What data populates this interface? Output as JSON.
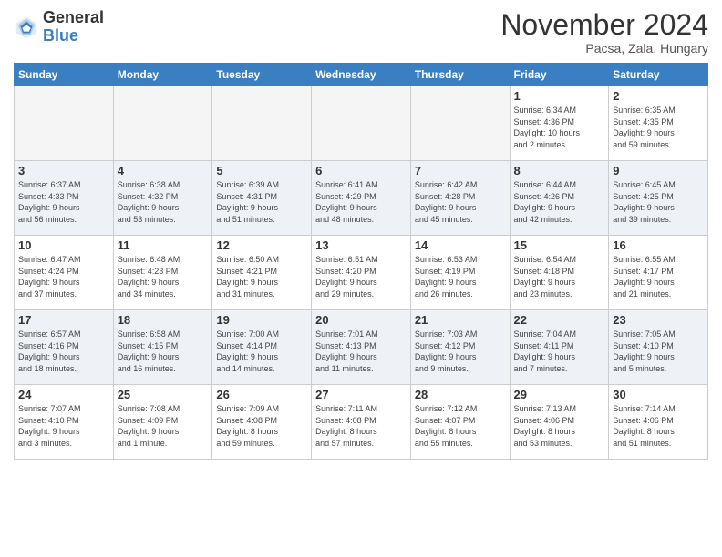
{
  "logo": {
    "general": "General",
    "blue": "Blue"
  },
  "header": {
    "title": "November 2024",
    "location": "Pacsa, Zala, Hungary"
  },
  "columns": [
    "Sunday",
    "Monday",
    "Tuesday",
    "Wednesday",
    "Thursday",
    "Friday",
    "Saturday"
  ],
  "weeks": [
    [
      {
        "day": "",
        "info": ""
      },
      {
        "day": "",
        "info": ""
      },
      {
        "day": "",
        "info": ""
      },
      {
        "day": "",
        "info": ""
      },
      {
        "day": "",
        "info": ""
      },
      {
        "day": "1",
        "info": "Sunrise: 6:34 AM\nSunset: 4:36 PM\nDaylight: 10 hours\nand 2 minutes."
      },
      {
        "day": "2",
        "info": "Sunrise: 6:35 AM\nSunset: 4:35 PM\nDaylight: 9 hours\nand 59 minutes."
      }
    ],
    [
      {
        "day": "3",
        "info": "Sunrise: 6:37 AM\nSunset: 4:33 PM\nDaylight: 9 hours\nand 56 minutes."
      },
      {
        "day": "4",
        "info": "Sunrise: 6:38 AM\nSunset: 4:32 PM\nDaylight: 9 hours\nand 53 minutes."
      },
      {
        "day": "5",
        "info": "Sunrise: 6:39 AM\nSunset: 4:31 PM\nDaylight: 9 hours\nand 51 minutes."
      },
      {
        "day": "6",
        "info": "Sunrise: 6:41 AM\nSunset: 4:29 PM\nDaylight: 9 hours\nand 48 minutes."
      },
      {
        "day": "7",
        "info": "Sunrise: 6:42 AM\nSunset: 4:28 PM\nDaylight: 9 hours\nand 45 minutes."
      },
      {
        "day": "8",
        "info": "Sunrise: 6:44 AM\nSunset: 4:26 PM\nDaylight: 9 hours\nand 42 minutes."
      },
      {
        "day": "9",
        "info": "Sunrise: 6:45 AM\nSunset: 4:25 PM\nDaylight: 9 hours\nand 39 minutes."
      }
    ],
    [
      {
        "day": "10",
        "info": "Sunrise: 6:47 AM\nSunset: 4:24 PM\nDaylight: 9 hours\nand 37 minutes."
      },
      {
        "day": "11",
        "info": "Sunrise: 6:48 AM\nSunset: 4:23 PM\nDaylight: 9 hours\nand 34 minutes."
      },
      {
        "day": "12",
        "info": "Sunrise: 6:50 AM\nSunset: 4:21 PM\nDaylight: 9 hours\nand 31 minutes."
      },
      {
        "day": "13",
        "info": "Sunrise: 6:51 AM\nSunset: 4:20 PM\nDaylight: 9 hours\nand 29 minutes."
      },
      {
        "day": "14",
        "info": "Sunrise: 6:53 AM\nSunset: 4:19 PM\nDaylight: 9 hours\nand 26 minutes."
      },
      {
        "day": "15",
        "info": "Sunrise: 6:54 AM\nSunset: 4:18 PM\nDaylight: 9 hours\nand 23 minutes."
      },
      {
        "day": "16",
        "info": "Sunrise: 6:55 AM\nSunset: 4:17 PM\nDaylight: 9 hours\nand 21 minutes."
      }
    ],
    [
      {
        "day": "17",
        "info": "Sunrise: 6:57 AM\nSunset: 4:16 PM\nDaylight: 9 hours\nand 18 minutes."
      },
      {
        "day": "18",
        "info": "Sunrise: 6:58 AM\nSunset: 4:15 PM\nDaylight: 9 hours\nand 16 minutes."
      },
      {
        "day": "19",
        "info": "Sunrise: 7:00 AM\nSunset: 4:14 PM\nDaylight: 9 hours\nand 14 minutes."
      },
      {
        "day": "20",
        "info": "Sunrise: 7:01 AM\nSunset: 4:13 PM\nDaylight: 9 hours\nand 11 minutes."
      },
      {
        "day": "21",
        "info": "Sunrise: 7:03 AM\nSunset: 4:12 PM\nDaylight: 9 hours\nand 9 minutes."
      },
      {
        "day": "22",
        "info": "Sunrise: 7:04 AM\nSunset: 4:11 PM\nDaylight: 9 hours\nand 7 minutes."
      },
      {
        "day": "23",
        "info": "Sunrise: 7:05 AM\nSunset: 4:10 PM\nDaylight: 9 hours\nand 5 minutes."
      }
    ],
    [
      {
        "day": "24",
        "info": "Sunrise: 7:07 AM\nSunset: 4:10 PM\nDaylight: 9 hours\nand 3 minutes."
      },
      {
        "day": "25",
        "info": "Sunrise: 7:08 AM\nSunset: 4:09 PM\nDaylight: 9 hours\nand 1 minute."
      },
      {
        "day": "26",
        "info": "Sunrise: 7:09 AM\nSunset: 4:08 PM\nDaylight: 8 hours\nand 59 minutes."
      },
      {
        "day": "27",
        "info": "Sunrise: 7:11 AM\nSunset: 4:08 PM\nDaylight: 8 hours\nand 57 minutes."
      },
      {
        "day": "28",
        "info": "Sunrise: 7:12 AM\nSunset: 4:07 PM\nDaylight: 8 hours\nand 55 minutes."
      },
      {
        "day": "29",
        "info": "Sunrise: 7:13 AM\nSunset: 4:06 PM\nDaylight: 8 hours\nand 53 minutes."
      },
      {
        "day": "30",
        "info": "Sunrise: 7:14 AM\nSunset: 4:06 PM\nDaylight: 8 hours\nand 51 minutes."
      }
    ]
  ]
}
